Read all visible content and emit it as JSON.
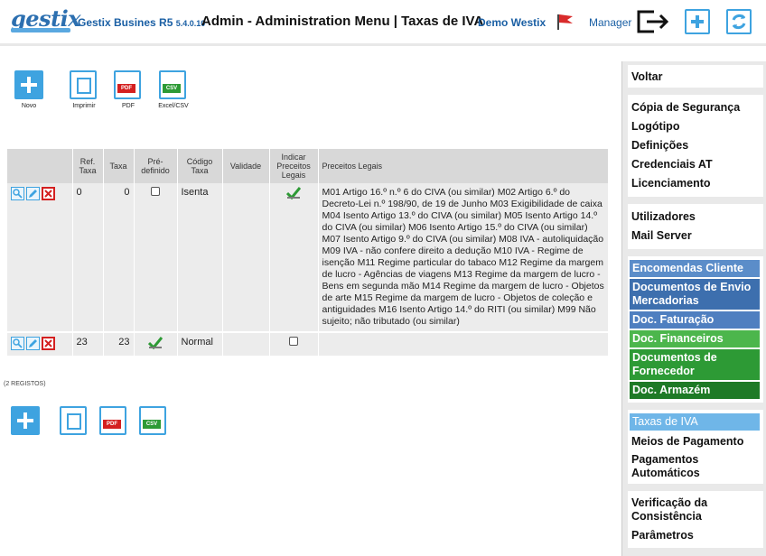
{
  "header": {
    "logo": "gestix",
    "app_name": "Gestix Busines R5",
    "version": "5.4.0.10",
    "title": "Admin - Administration Menu | Taxas de IVA",
    "company": "Demo Westix",
    "role": "Manager"
  },
  "toolbar_top": {
    "new": "Novo",
    "print": "Imprimir",
    "pdf": "PDF",
    "excel": "Excel/CSV",
    "pdf_badge": "PDF",
    "csv_badge": "CSV"
  },
  "toolbar_bottom": {
    "pdf_badge": "PDF",
    "csv_badge": "CSV"
  },
  "table": {
    "headers": {
      "ref": "Ref. Taxa",
      "taxa": "Taxa",
      "default": "Pré-definido",
      "code": "Código Taxa",
      "validity": "Validade",
      "indicate": "Indicar Preceitos Legais",
      "legal": "Preceitos Legais"
    },
    "rows": [
      {
        "ref": "0",
        "taxa": "0",
        "default": false,
        "code": "Isenta",
        "validity": "",
        "indicate": true,
        "legal": "M01 Artigo 16.º n.º 6 do CIVA (ou similar) M02 Artigo 6.º do Decreto-Lei n.º 198/90, de 19 de Junho M03 Exigibilidade de caixa M04 Isento Artigo 13.º do CIVA (ou similar) M05 Isento Artigo 14.º do CIVA (ou similar) M06 Isento Artigo 15.º do CIVA (ou similar) M07 Isento Artigo 9.º do CIVA (ou similar) M08 IVA - autoliquidação M09 IVA - não confere direito a dedução M10 IVA - Regime de isenção M11 Regime particular do tabaco M12 Regime da margem de lucro - Agências de viagens M13 Regime da margem de lucro - Bens em segunda mão M14 Regime da margem de lucro - Objetos de arte M15 Regime da margem de lucro - Objetos de coleção e antiguidades M16 Isento Artigo 14.º do RITI (ou similar) M99 Não sujeito; não tributado (ou similar)"
      },
      {
        "ref": "23",
        "taxa": "23",
        "default": true,
        "code": "Normal",
        "validity": "",
        "indicate": false,
        "legal": ""
      }
    ]
  },
  "records_count": "(2 REGISTOS)",
  "sidebar": {
    "back": "Voltar",
    "group1": [
      "Cópia de Segurança",
      "Logótipo",
      "Definições",
      "Credenciais AT",
      "Licenciamento"
    ],
    "group2": [
      "Utilizadores",
      "Mail Server"
    ],
    "colored": [
      {
        "label": "Encomendas Cliente",
        "color": "#5b8dc9"
      },
      {
        "label": "Documentos de Envio Mercadorias",
        "color": "#3d6fae"
      },
      {
        "label": "Doc. Faturação",
        "color": "#4f7fc0"
      },
      {
        "label": "Doc. Financeiros",
        "color": "#4cb64c"
      },
      {
        "label": "Documentos de Fornecedor",
        "color": "#2d9a35"
      },
      {
        "label": "Doc. Armazém",
        "color": "#1e7a26"
      }
    ],
    "group3_active": "Taxas de IVA",
    "group3": [
      "Meios de Pagamento",
      "Pagamentos Automáticos"
    ],
    "group4": [
      "Verificação da Consistência",
      "Parâmetros"
    ]
  },
  "colors": {
    "accent": "#3ea3e0",
    "brand": "#1a5fa4",
    "active_item": "#6fb6e8"
  }
}
